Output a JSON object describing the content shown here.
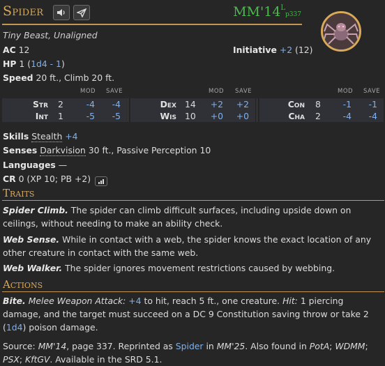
{
  "header": {
    "name": "Spider",
    "source": "MM'14",
    "source_sup": "L",
    "page": "p337",
    "accent": "#d8a95a",
    "source_color": "#4db84d"
  },
  "type_line": "Tiny Beast, Unaligned",
  "ac": {
    "label": "AC",
    "value": "12"
  },
  "hp": {
    "label": "HP",
    "value": "1",
    "formula": "1d4 - 1"
  },
  "speed": {
    "label": "Speed",
    "value": "20 ft., Climb 20 ft."
  },
  "initiative": {
    "label": "Initiative",
    "mod": "+2",
    "score": "(12)"
  },
  "ability_headers": {
    "mod": "MOD",
    "save": "SAVE"
  },
  "abilities": [
    {
      "name": "Str",
      "score": "2",
      "mod": "-4",
      "save": "-4"
    },
    {
      "name": "Int",
      "score": "1",
      "mod": "-5",
      "save": "-5"
    },
    {
      "name": "Dex",
      "score": "14",
      "mod": "+2",
      "save": "+2"
    },
    {
      "name": "Wis",
      "score": "10",
      "mod": "+0",
      "save": "+0"
    },
    {
      "name": "Con",
      "score": "8",
      "mod": "-1",
      "save": "-1"
    },
    {
      "name": "Cha",
      "score": "2",
      "mod": "-4",
      "save": "-4"
    }
  ],
  "skills": {
    "label": "Skills",
    "name": "Stealth",
    "mod": "+4"
  },
  "senses": {
    "label": "Senses",
    "link": "Darkvision",
    "rest": "30 ft., Passive Perception 10"
  },
  "languages": {
    "label": "Languages",
    "value": "—"
  },
  "cr": {
    "label": "CR",
    "value": "0 (XP 10; PB +2)"
  },
  "traits": {
    "title": "Traits",
    "items": [
      {
        "name": "Spider Climb.",
        "text": "The spider can climb difficult surfaces, including upside down on ceilings, without needing to make an ability check."
      },
      {
        "name": "Web Sense.",
        "text": "While in contact with a web, the spider knows the exact location of any other creature in contact with the same web."
      },
      {
        "name": "Web Walker.",
        "text": "The spider ignores movement restrictions caused by webbing."
      }
    ]
  },
  "actions": {
    "title": "Actions",
    "bite": {
      "name": "Bite.",
      "attack": "Melee Weapon Attack:",
      "bonus": "+4",
      "t1": "to hit, reach 5 ft., one creature.",
      "hit": "Hit:",
      "t2": "1 piercing damage, and the target must succeed on a DC 9 Constitution saving throw or take 2 (",
      "dice": "1d4",
      "t3": ") poison damage."
    }
  },
  "source_line": {
    "label": "Source:",
    "book": "MM'14",
    "t1": ", page 337. Reprinted as",
    "link": "Spider",
    "t2": "in",
    "book2": "MM'25",
    "t3": ". Also found in",
    "also1": "PotA",
    "sep1": ";",
    "also2": "WDMM",
    "sep2": ";",
    "also3": "PSX",
    "sep3": ";",
    "also4": "KftGV",
    "t4": ". Available in the SRD 5.1."
  }
}
